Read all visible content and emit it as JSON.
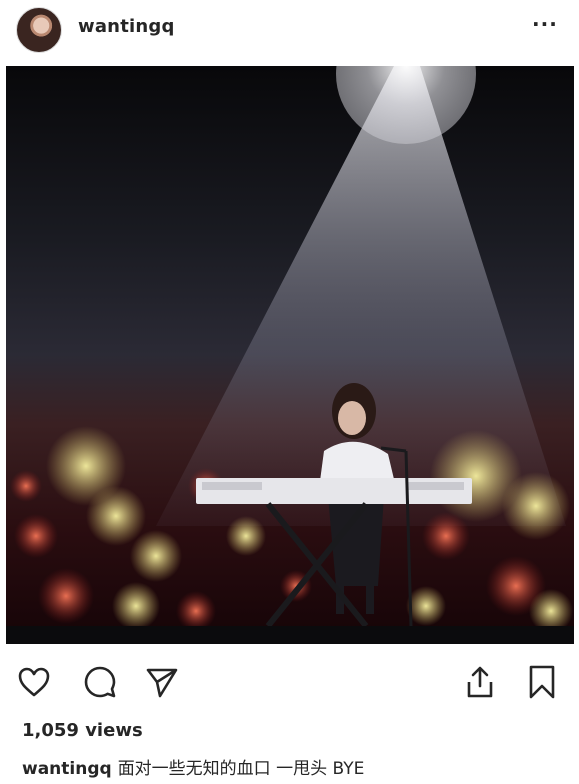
{
  "post": {
    "username": "wantingq",
    "more_icon": "more-horizontal-icon"
  },
  "actions": {
    "like_icon": "heart-icon",
    "comment_icon": "comment-icon",
    "share_icon": "send-icon",
    "upload_icon": "upload-icon",
    "save_icon": "bookmark-icon"
  },
  "stats": {
    "views": "1,059 views"
  },
  "caption": {
    "username": "wantingq",
    "text": "面对一些无知的血口 一甩头 BYE"
  },
  "colors": {
    "text": "#262626",
    "background": "#ffffff"
  }
}
